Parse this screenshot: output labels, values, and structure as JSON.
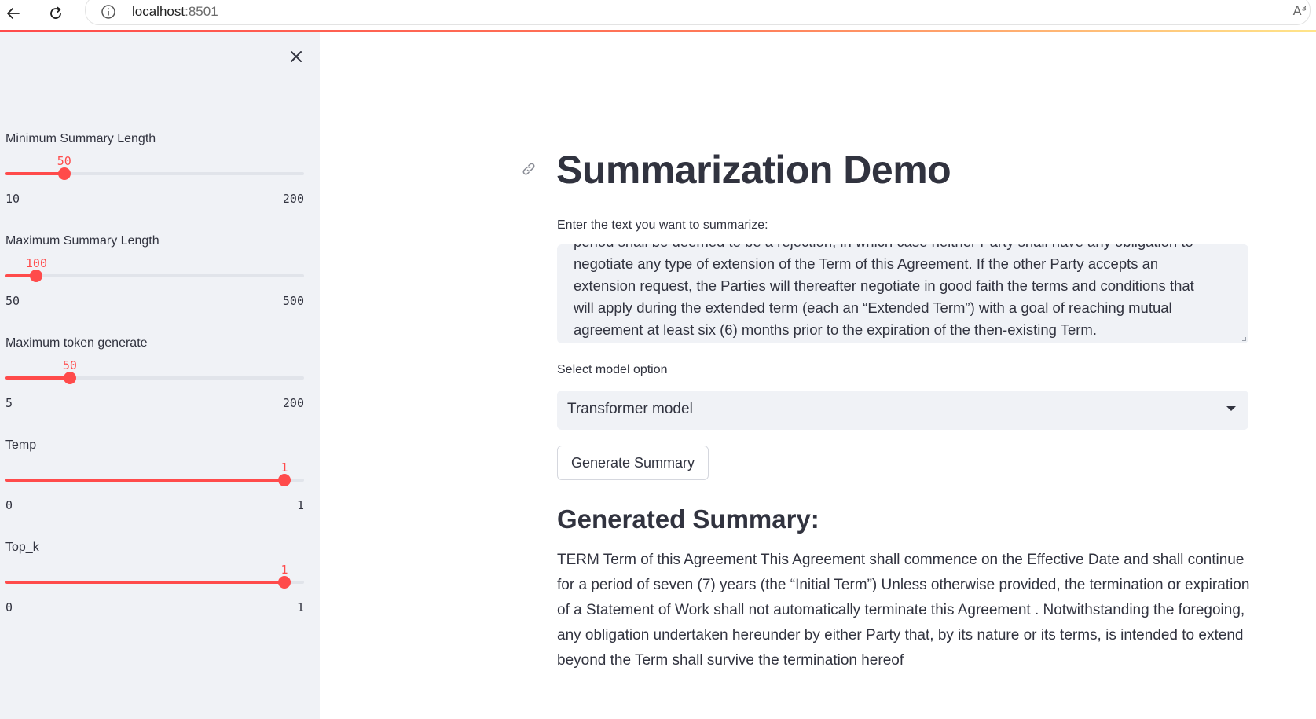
{
  "browser": {
    "url_host": "localhost",
    "url_port": ":8501",
    "read_aloud_label": "A³"
  },
  "sidebar": {
    "sliders": [
      {
        "label": "Minimum Summary Length",
        "value": "50",
        "min": "10",
        "max": "200",
        "fraction": 0.2105
      },
      {
        "label": "Maximum Summary Length",
        "value": "100",
        "min": "50",
        "max": "500",
        "fraction": 0.1111
      },
      {
        "label": "Maximum token generate",
        "value": "50",
        "min": "5",
        "max": "200",
        "fraction": 0.2308
      },
      {
        "label": "Temp",
        "value": "1",
        "min": "0",
        "max": "1",
        "fraction": 1.0
      },
      {
        "label": "Top_k",
        "value": "1",
        "min": "0",
        "max": "1",
        "fraction": 1.0
      }
    ]
  },
  "main": {
    "title": "Summarization Demo",
    "input_label": "Enter the text you want to summarize:",
    "input_lines": [
      "period shall be deemed to be a rejection, in which case neither Party shall have any obligation to",
      "negotiate any type of extension of the Term of this Agreement. If the other Party accepts an",
      "extension request, the Parties will thereafter negotiate in good faith the terms and conditions that",
      "will apply during the extended term (each an “Extended Term”) with a goal of reaching mutual",
      "agreement at least six (6) months prior to the expiration of the then-existing Term."
    ],
    "select_label": "Select model option",
    "select_value": "Transformer model",
    "generate_button": "Generate Summary",
    "summary_heading": "Generated Summary:",
    "summary_lines": [
      "TERM Term of this Agreement This Agreement shall commence on the Effective Date and shall continue",
      "for a period of seven (7) years (the “Initial Term”) Unless otherwise provided, the termination or expiration",
      "of a Statement of Work shall not automatically terminate this Agreement . Notwithstanding the foregoing,",
      "any obligation undertaken hereunder by either Party that, by its nature or its terms, is intended to extend",
      "beyond the Term shall survive the termination hereof"
    ]
  },
  "colors": {
    "accent": "#ff4b4b",
    "sidebar_bg": "#f0f2f6",
    "text": "#31333f"
  }
}
